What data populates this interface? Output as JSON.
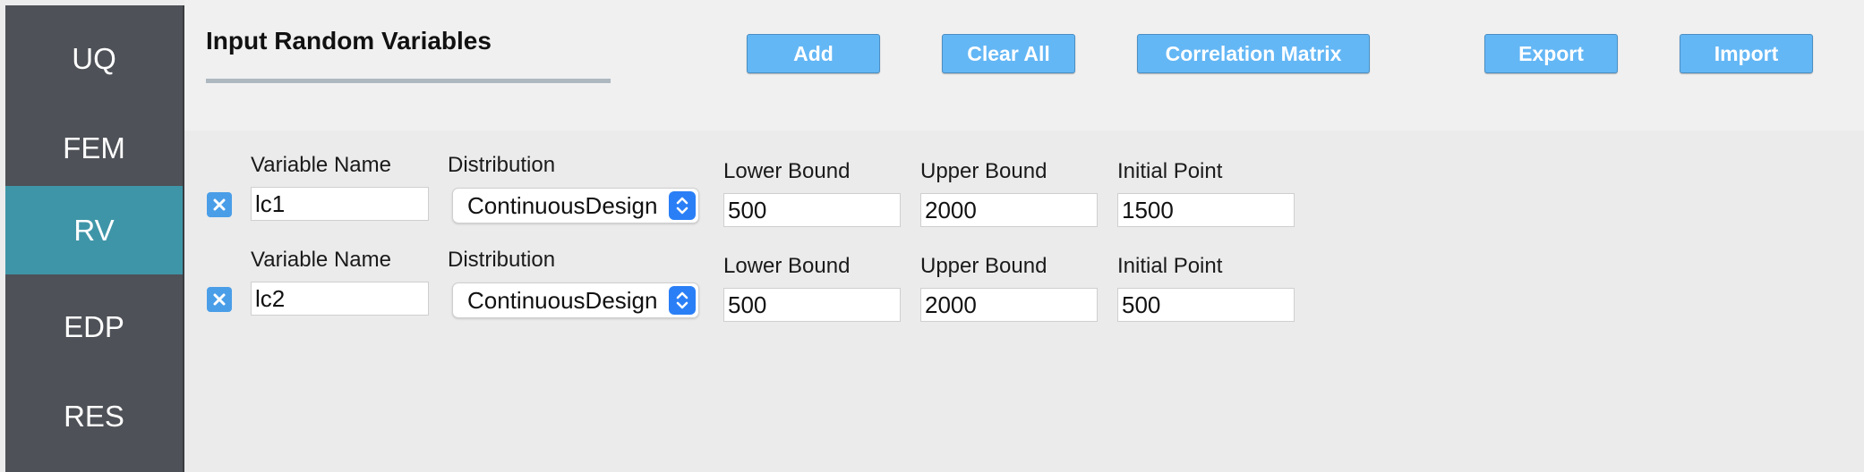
{
  "sidebar": {
    "items": [
      {
        "label": "UQ",
        "active": false
      },
      {
        "label": "FEM",
        "active": false
      },
      {
        "label": "RV",
        "active": true
      },
      {
        "label": "EDP",
        "active": false
      },
      {
        "label": "RES",
        "active": false
      }
    ],
    "background": "#4e5157",
    "active_color": "#3f95a8"
  },
  "header": {
    "title": "Input Random Variables",
    "buttons": {
      "add": "Add",
      "clear_all": "Clear All",
      "correlation_matrix": "Correlation Matrix",
      "export": "Export",
      "import": "Import"
    },
    "button_color": "#64b7f5"
  },
  "variables": [
    {
      "selected": true,
      "name_label": "Variable Name",
      "name": "lc1",
      "distribution_label": "Distribution",
      "distribution": "ContinuousDesign",
      "lower_label": "Lower Bound",
      "lower": "500",
      "upper_label": "Upper Bound",
      "upper": "2000",
      "initial_label": "Initial Point",
      "initial": "1500"
    },
    {
      "selected": true,
      "name_label": "Variable Name",
      "name": "lc2",
      "distribution_label": "Distribution",
      "distribution": "ContinuousDesign",
      "lower_label": "Lower Bound",
      "lower": "500",
      "upper_label": "Upper Bound",
      "upper": "2000",
      "initial_label": "Initial Point",
      "initial": "500"
    }
  ],
  "icons": {
    "checkbox": "close-x-icon",
    "select_arrow": "chevron-up-down-icon"
  }
}
